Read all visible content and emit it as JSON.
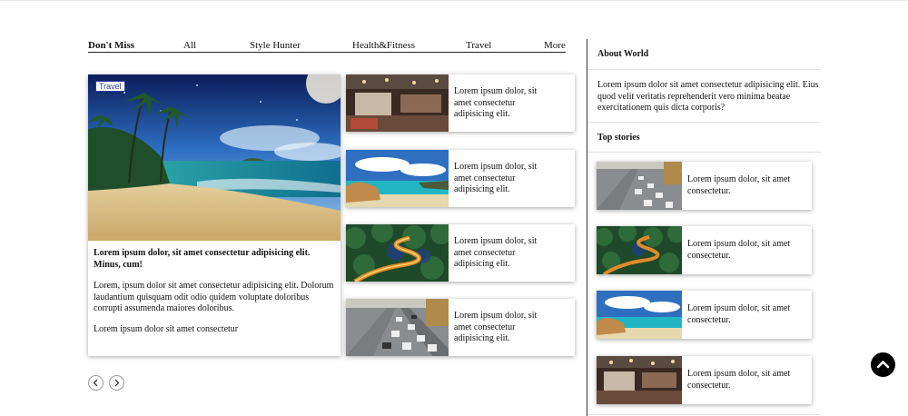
{
  "nav": {
    "items": [
      "Don't Miss",
      "All",
      "Style Hunter",
      "Health&Fitness",
      "Travel",
      "More"
    ]
  },
  "featured": {
    "tag": "Travel",
    "title": "Lorem ipsum dolor, sit amet consectetur adipisicing elit. Minus, cum!",
    "body": "Lorem, ipsum dolor sit amet consectetur adipisicing elit. Dolorum laudantium quisquam odit odio quidem voluptate doloribus corrupti assumenda maiores doloribus.",
    "footer": "Lorem ipsum dolor sit amet consectetur"
  },
  "side_cards": [
    {
      "text": "Lorem ipsum dolor, sit amet consectetur adipisicing elit.",
      "image": "restaurant-photo"
    },
    {
      "text": "Lorem ipsum dolor, sit amet consectetur adipisicing elit.",
      "image": "beach-rocks-photo"
    },
    {
      "text": "Lorem ipsum dolor, sit amet consectetur adipisicing elit.",
      "image": "winding-road-photo"
    },
    {
      "text": "Lorem ipsum dolor, sit amet consectetur adipisicing elit.",
      "image": "highway-traffic-photo"
    }
  ],
  "pager": {
    "prev_icon": "chevron-left-icon",
    "next_icon": "chevron-right-icon"
  },
  "sidebar": {
    "about_title": "About World",
    "about_text": "Lorem ipsum dolor sit amet consectetur adipisicing elit. Eius quod velit veritatis reprehenderit vero minima beatae exercitationem quis dicta corporis?",
    "top_title": "Top stories",
    "stories": [
      {
        "text": "Lorem ipsum dolor, sit amet consectetur.",
        "image": "highway-traffic-photo"
      },
      {
        "text": "Lorem ipsum dolor, sit amet consectetur.",
        "image": "winding-road-photo"
      },
      {
        "text": "Lorem ipsum dolor, sit amet consectetur.",
        "image": "beach-rocks-photo"
      },
      {
        "text": "Lorem ipsum dolor, sit amet consectetur.",
        "image": "restaurant-photo"
      }
    ]
  },
  "scroll_top_icon": "chevron-up-icon"
}
